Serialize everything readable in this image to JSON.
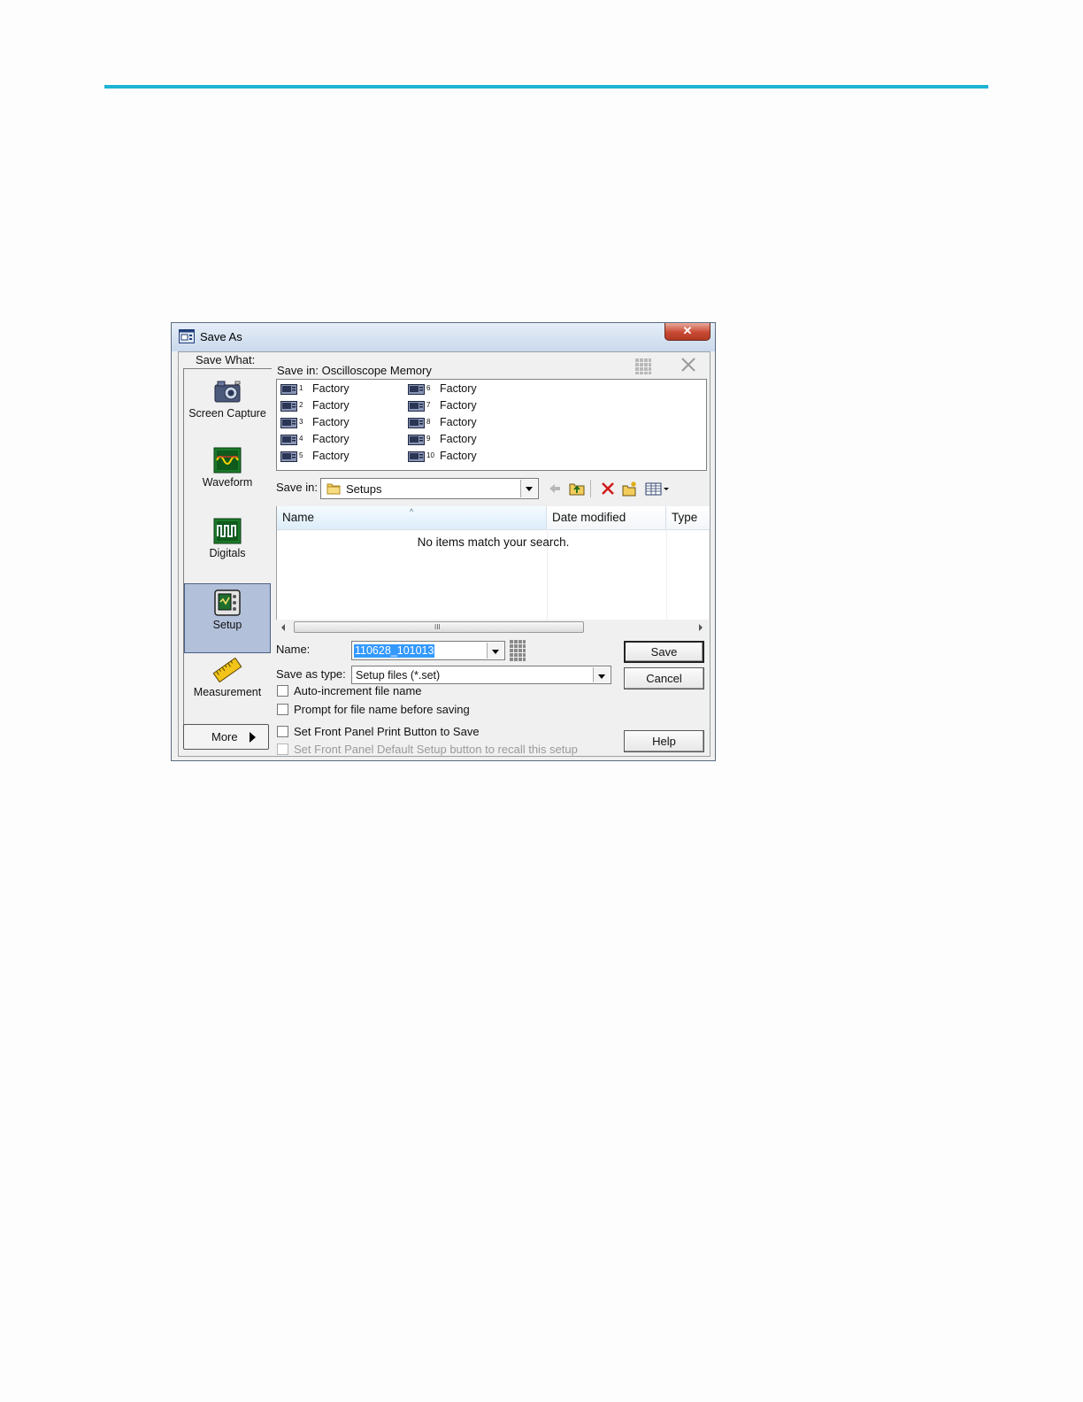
{
  "window": {
    "title": "Save As",
    "close_glyph": "✕"
  },
  "save_what": {
    "label": "Save What:",
    "items": [
      {
        "label": "Screen Capture",
        "icon": "camera-icon"
      },
      {
        "label": "Waveform",
        "icon": "waveform-icon"
      },
      {
        "label": "Digitals",
        "icon": "digitals-icon"
      },
      {
        "label": "Setup",
        "icon": "setup-icon",
        "selected": true
      },
      {
        "label": "Measurement",
        "icon": "measurement-icon"
      }
    ],
    "more_label": "More"
  },
  "memory": {
    "header": "Save in: Oscilloscope Memory",
    "slots": [
      {
        "num": "1",
        "label": "Factory"
      },
      {
        "num": "2",
        "label": "Factory"
      },
      {
        "num": "3",
        "label": "Factory"
      },
      {
        "num": "4",
        "label": "Factory"
      },
      {
        "num": "5",
        "label": "Factory"
      },
      {
        "num": "6",
        "label": "Factory"
      },
      {
        "num": "7",
        "label": "Factory"
      },
      {
        "num": "8",
        "label": "Factory"
      },
      {
        "num": "9",
        "label": "Factory"
      },
      {
        "num": "10",
        "label": "Factory"
      }
    ]
  },
  "save_in": {
    "label": "Save in:",
    "value": "Setups"
  },
  "file_list": {
    "columns": [
      "Name",
      "Date modified",
      "Type"
    ],
    "empty_message": "No items match your search.",
    "scroll_grip": "III"
  },
  "form": {
    "name_label": "Name:",
    "name_value": "110628_101013",
    "type_label": "Save as type:",
    "type_value": "Setup files (*.set)",
    "checkboxes": [
      {
        "label": "Auto-increment file name",
        "checked": false,
        "enabled": true
      },
      {
        "label": "Prompt for file name before saving",
        "checked": false,
        "enabled": true
      },
      {
        "label": "Set Front Panel Print Button to Save",
        "checked": false,
        "enabled": true
      },
      {
        "label": "Set Front Panel Default Setup button to recall this setup",
        "checked": false,
        "enabled": false
      }
    ]
  },
  "buttons": {
    "save": "Save",
    "cancel": "Cancel",
    "help": "Help"
  }
}
